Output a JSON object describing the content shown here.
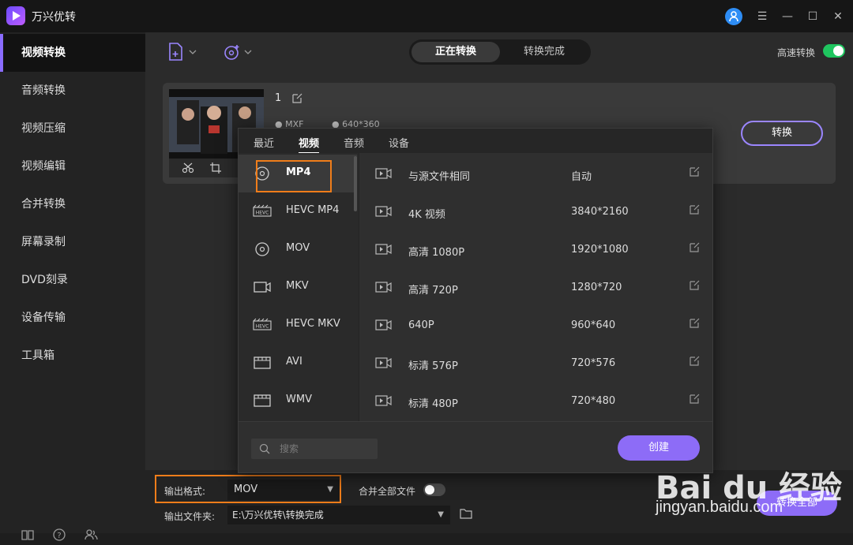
{
  "app": {
    "title": "万兴优转"
  },
  "sidebar": {
    "items": [
      {
        "label": "视频转换",
        "active": true
      },
      {
        "label": "音频转换"
      },
      {
        "label": "视频压缩"
      },
      {
        "label": "视频编辑"
      },
      {
        "label": "合并转换"
      },
      {
        "label": "屏幕录制"
      },
      {
        "label": "DVD刻录"
      },
      {
        "label": "设备传输"
      },
      {
        "label": "工具箱"
      }
    ]
  },
  "header": {
    "tabs": [
      {
        "label": "正在转换",
        "active": true
      },
      {
        "label": "转换完成"
      }
    ],
    "fast_convert_label": "高速转换",
    "fast_convert_enabled": true
  },
  "file": {
    "index": "1",
    "format": "MXF",
    "resolution": "640*360",
    "convert_label": "转换"
  },
  "format_popup": {
    "tabs": [
      {
        "label": "最近"
      },
      {
        "label": "视频",
        "active": true
      },
      {
        "label": "音频"
      },
      {
        "label": "设备"
      }
    ],
    "formats": [
      {
        "label": "MP4",
        "active": true
      },
      {
        "label": "HEVC MP4"
      },
      {
        "label": "MOV"
      },
      {
        "label": "MKV"
      },
      {
        "label": "HEVC MKV"
      },
      {
        "label": "AVI"
      },
      {
        "label": "WMV"
      }
    ],
    "presets": [
      {
        "name": "与源文件相同",
        "resolution": "自动"
      },
      {
        "name": "4K 视频",
        "resolution": "3840*2160"
      },
      {
        "name": "高清 1080P",
        "resolution": "1920*1080"
      },
      {
        "name": "高清 720P",
        "resolution": "1280*720"
      },
      {
        "name": "640P",
        "resolution": "960*640"
      },
      {
        "name": "标清 576P",
        "resolution": "720*576"
      },
      {
        "name": "标清 480P",
        "resolution": "720*480"
      }
    ],
    "search_placeholder": "搜索",
    "create_label": "创建"
  },
  "bottom": {
    "output_format_label": "输出格式:",
    "output_format_value": "MOV",
    "merge_label": "合并全部文件",
    "merge_enabled": false,
    "output_folder_label": "输出文件夹:",
    "output_folder_value": "E:\\万兴优转\\转换完成",
    "convert_all_label": "转换全部"
  },
  "watermark": {
    "text": "Bai du 经验",
    "url": "jingyan.baidu.com"
  },
  "colors": {
    "accent": "#8d6cf7",
    "highlight": "#f07d1a",
    "toggle_on": "#1fc55f"
  }
}
